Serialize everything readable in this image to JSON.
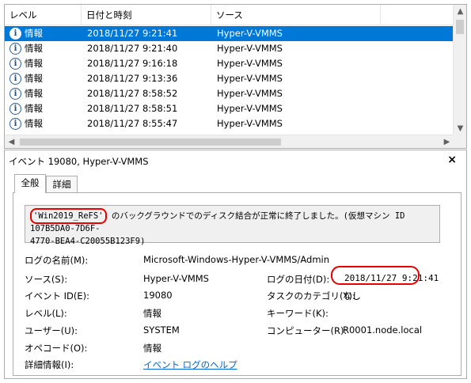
{
  "list": {
    "headers": [
      "レベル",
      "日付と時刻",
      "ソース"
    ],
    "rows": [
      {
        "level": "情報",
        "datetime": "2018/11/27 9:21:41",
        "source": "Hyper-V-VMMS",
        "selected": true
      },
      {
        "level": "情報",
        "datetime": "2018/11/27 9:21:40",
        "source": "Hyper-V-VMMS"
      },
      {
        "level": "情報",
        "datetime": "2018/11/27 9:16:18",
        "source": "Hyper-V-VMMS"
      },
      {
        "level": "情報",
        "datetime": "2018/11/27 9:13:36",
        "source": "Hyper-V-VMMS"
      },
      {
        "level": "情報",
        "datetime": "2018/11/27 8:58:52",
        "source": "Hyper-V-VMMS"
      },
      {
        "level": "情報",
        "datetime": "2018/11/27 8:58:51",
        "source": "Hyper-V-VMMS"
      },
      {
        "level": "情報",
        "datetime": "2018/11/27 8:55:47",
        "source": "Hyper-V-VMMS"
      }
    ]
  },
  "detail": {
    "title": "イベント 19080, Hyper-V-VMMS",
    "close": "×",
    "tabs": [
      "全般",
      "詳細"
    ],
    "message": {
      "prefix": "'",
      "highlight": "Win2019_ReFS'",
      "line1_rest": " のバックグラウンドでのディスク結合が正常に終了しました。(仮想マシン ID 107B5DA0-7D6F-",
      "line2": "4770-BEA4-C20055B123F9)"
    },
    "props": {
      "log_name_label": "ログの名前(M):",
      "log_name_value": "Microsoft-Windows-Hyper-V-VMMS/Admin",
      "source_label": "ソース(S):",
      "source_value": "Hyper-V-VMMS",
      "logged_label": "ログの日付(D):",
      "logged_value": "2018/11/27 9:21:41",
      "event_id_label": "イベント ID(E):",
      "event_id_value": "19080",
      "task_label": "タスクのカテゴリ(Y):",
      "task_value": "なし",
      "level_label": "レベル(L):",
      "level_value": "情報",
      "keywords_label": "キーワード(K):",
      "keywords_value": "",
      "user_label": "ユーザー(U):",
      "user_value": "SYSTEM",
      "computer_label": "コンピューター(R):",
      "computer_value": "R0001.node.local",
      "opcode_label": "オペコード(O):",
      "opcode_value": "情報",
      "more_info_label": "詳細情報(I):",
      "more_info_link": "イベント ログのヘルプ"
    }
  },
  "icons": {
    "info": "info-icon",
    "scroll_up": "chevron-up-icon",
    "scroll_down": "chevron-down-icon",
    "scroll_left": "chevron-left-icon",
    "scroll_right": "chevron-right-icon"
  },
  "colors": {
    "selection": "#0078d7",
    "highlight_ring": "#e60000",
    "link": "#0066cc"
  }
}
